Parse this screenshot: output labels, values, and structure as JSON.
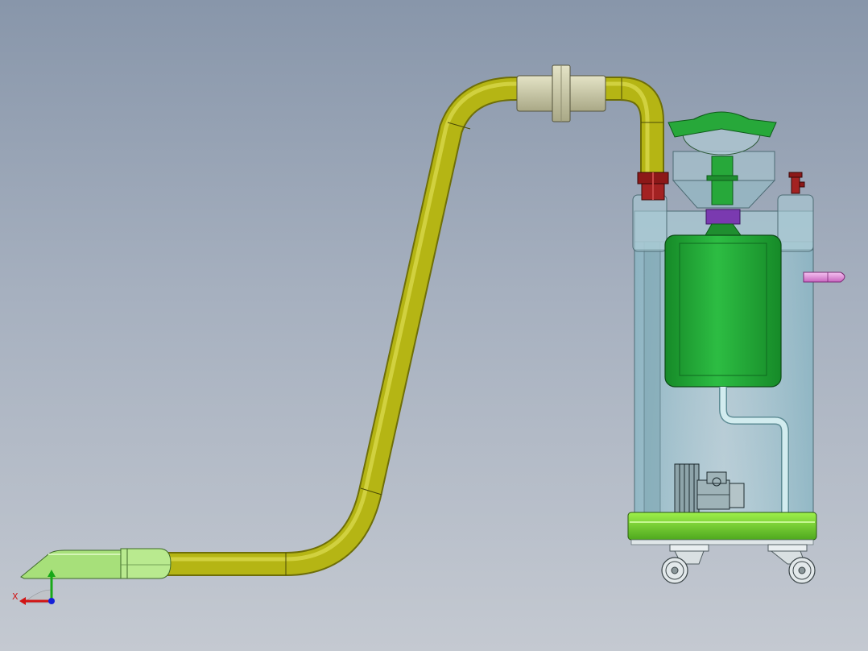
{
  "viewport": {
    "background_top": "#8896aa",
    "background_bottom": "#c4c9d1"
  },
  "triad": {
    "x_label": "X",
    "x_color": "#d11414",
    "y_color": "#18a818",
    "z_color": "#1420d8"
  },
  "colors": {
    "hose": "#b5b514",
    "hose_dark": "#6e6e08",
    "nozzle": "#a7e07a",
    "coupling": "#c9c8a6",
    "tank_glass": "#9ec4cf",
    "filter_body": "#27a83a",
    "base_plate": "#7edc33",
    "inlet_valve": "#8c1818",
    "motor_mount": "#7a3ab0",
    "side_handle": "#e58fe0"
  },
  "parts": [
    "suction-nozzle",
    "suction-hose",
    "hose-coupling",
    "inlet-valve",
    "filter-cap",
    "filter-canister",
    "collection-tank",
    "drain-pipe",
    "blower-motor",
    "base-plate",
    "caster-wheel-left",
    "caster-wheel-right",
    "side-handle"
  ]
}
